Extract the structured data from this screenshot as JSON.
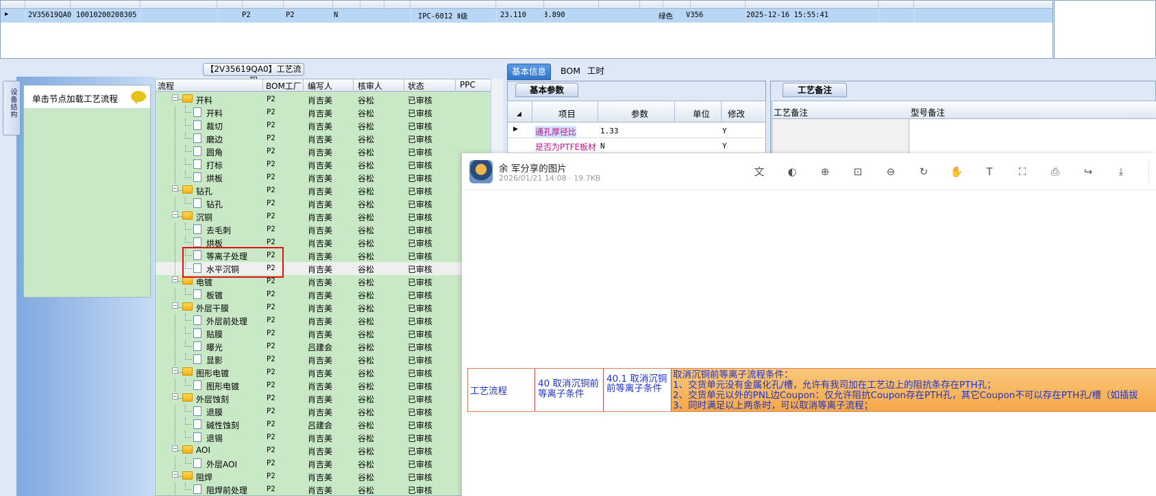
{
  "top_grid": {
    "row": {
      "code": "2V35619QA0",
      "order_no": "10010200208305",
      "factory1": "P2",
      "factory2": "P2",
      "flag": "N",
      "grade": "IPC-6012 Ⅱ级",
      "v1": "23.110",
      "v2": "8.890",
      "color": "绿色",
      "version": "V356",
      "datetime": "2025-12-16 15:55:41"
    }
  },
  "left_panel": {
    "vertical_tab": "设备结构",
    "hint": "单击节点加载工艺流程"
  },
  "process_panel": {
    "title": "【2V35619QA0】工艺流程",
    "columns": [
      "流程",
      "BOM工厂",
      "编写人",
      "核审人",
      "状态",
      "PPC"
    ],
    "rows": [
      {
        "name": "开料",
        "folder": true,
        "factory": "P2",
        "writer": "肖吉美",
        "reviewer": "谷松",
        "status": "已审核"
      },
      {
        "name": "开料",
        "folder": false,
        "factory": "P2",
        "writer": "肖吉美",
        "reviewer": "谷松",
        "status": "已审核"
      },
      {
        "name": "裁切",
        "folder": false,
        "factory": "P2",
        "writer": "肖吉美",
        "reviewer": "谷松",
        "status": "已审核"
      },
      {
        "name": "磨边",
        "folder": false,
        "factory": "P2",
        "writer": "肖吉美",
        "reviewer": "谷松",
        "status": "已审核"
      },
      {
        "name": "圆角",
        "folder": false,
        "factory": "P2",
        "writer": "肖吉美",
        "reviewer": "谷松",
        "status": "已审核"
      },
      {
        "name": "打标",
        "folder": false,
        "factory": "P2",
        "writer": "肖吉美",
        "reviewer": "谷松",
        "status": "已审核"
      },
      {
        "name": "烘板",
        "folder": false,
        "factory": "P2",
        "writer": "肖吉美",
        "reviewer": "谷松",
        "status": "已审核"
      },
      {
        "name": "钻孔",
        "folder": true,
        "factory": "P2",
        "writer": "肖吉美",
        "reviewer": "谷松",
        "status": "已审核"
      },
      {
        "name": "钻孔",
        "folder": false,
        "factory": "P2",
        "writer": "肖吉美",
        "reviewer": "谷松",
        "status": "已审核"
      },
      {
        "name": "沉铜",
        "folder": true,
        "factory": "P2",
        "writer": "肖吉美",
        "reviewer": "谷松",
        "status": "已审核"
      },
      {
        "name": "去毛刺",
        "folder": false,
        "factory": "P2",
        "writer": "肖吉美",
        "reviewer": "谷松",
        "status": "已审核"
      },
      {
        "name": "烘板",
        "folder": false,
        "factory": "P2",
        "writer": "肖吉美",
        "reviewer": "谷松",
        "status": "已审核"
      },
      {
        "name": "等离子处理",
        "folder": false,
        "factory": "P2",
        "writer": "肖吉美",
        "reviewer": "谷松",
        "status": "已审核"
      },
      {
        "name": "水平沉铜",
        "folder": false,
        "factory": "P2",
        "writer": "肖吉美",
        "reviewer": "谷松",
        "status": "已审核"
      },
      {
        "name": "电镀",
        "folder": true,
        "factory": "P2",
        "writer": "肖吉美",
        "reviewer": "谷松",
        "status": "已审核"
      },
      {
        "name": "板镀",
        "folder": false,
        "factory": "P2",
        "writer": "肖吉美",
        "reviewer": "谷松",
        "status": "已审核"
      },
      {
        "name": "外层干膜",
        "folder": true,
        "factory": "P2",
        "writer": "肖吉美",
        "reviewer": "谷松",
        "status": "已审核"
      },
      {
        "name": "外层前处理",
        "folder": false,
        "factory": "P2",
        "writer": "肖吉美",
        "reviewer": "谷松",
        "status": "已审核"
      },
      {
        "name": "贴膜",
        "folder": false,
        "factory": "P2",
        "writer": "肖吉美",
        "reviewer": "谷松",
        "status": "已审核"
      },
      {
        "name": "曝光",
        "folder": false,
        "factory": "P2",
        "writer": "吕建会",
        "reviewer": "谷松",
        "status": "已审核"
      },
      {
        "name": "显影",
        "folder": false,
        "factory": "P2",
        "writer": "肖吉美",
        "reviewer": "谷松",
        "status": "已审核"
      },
      {
        "name": "图形电镀",
        "folder": true,
        "factory": "P2",
        "writer": "肖吉美",
        "reviewer": "谷松",
        "status": "已审核"
      },
      {
        "name": "图形电镀",
        "folder": false,
        "factory": "P2",
        "writer": "肖吉美",
        "reviewer": "谷松",
        "status": "已审核"
      },
      {
        "name": "外层蚀刻",
        "folder": true,
        "factory": "P2",
        "writer": "肖吉美",
        "reviewer": "谷松",
        "status": "已审核"
      },
      {
        "name": "退膜",
        "folder": false,
        "factory": "P2",
        "writer": "肖吉美",
        "reviewer": "谷松",
        "status": "已审核"
      },
      {
        "name": "碱性蚀刻",
        "folder": false,
        "factory": "P2",
        "writer": "吕建会",
        "reviewer": "谷松",
        "status": "已审核"
      },
      {
        "name": "退锡",
        "folder": false,
        "factory": "P2",
        "writer": "肖吉美",
        "reviewer": "谷松",
        "status": "已审核"
      },
      {
        "name": "AOI",
        "folder": true,
        "factory": "P2",
        "writer": "肖吉美",
        "reviewer": "谷松",
        "status": "已审核"
      },
      {
        "name": "外层AOI",
        "folder": false,
        "factory": "P2",
        "writer": "肖吉美",
        "reviewer": "谷松",
        "status": "已审核"
      },
      {
        "name": "阻焊",
        "folder": true,
        "factory": "P2",
        "writer": "肖吉美",
        "reviewer": "谷松",
        "status": "已审核"
      },
      {
        "name": "阻焊前处理",
        "folder": false,
        "factory": "P2",
        "writer": "肖吉美",
        "reviewer": "谷松",
        "status": "已审核"
      }
    ]
  },
  "right_tabs": [
    "基本信息",
    "BOM",
    "工时"
  ],
  "basic_params": {
    "tab": "基本参数",
    "columns": [
      "项目",
      "参数",
      "单位",
      "修改"
    ],
    "rows": [
      {
        "name": "通孔厚径比",
        "value": "1.33",
        "unit": "",
        "modify": "Y"
      },
      {
        "name": "是否为PTFE板材",
        "value": "N",
        "unit": "",
        "modify": "Y"
      }
    ]
  },
  "process_notes": {
    "tab": "工艺备注",
    "columns": [
      "工艺备注",
      "型号备注"
    ]
  },
  "viewer": {
    "title": "余 军分享的图片",
    "subtitle": "2026/01/21 14:08 · 19.7KB",
    "tools": [
      "translate-icon",
      "contrast-icon",
      "zoom-in-icon",
      "actual-size-icon",
      "zoom-out-icon",
      "rotate-icon",
      "hand-icon",
      "text-extract-icon",
      "screenshot-icon",
      "print-icon",
      "share-icon",
      "download-icon"
    ],
    "image": {
      "col1": "工艺流程",
      "col2": "40 取消沉铜前等离子条件",
      "col3": "40.1 取消沉铜前等离子条件",
      "lines": [
        "取消沉铜前等离子流程条件：",
        "1、交货单元没有金属化孔/槽，允许有我司加在工艺边上的阻抗条存在PTH孔；",
        "2、交货单元以外的PNL边Coupon：仅允许阻抗Coupon存在PTH孔，其它Coupon不可以存在PTH孔/槽（如插拔",
        "3、同时满足以上两条时，可以取消等离子流程；"
      ]
    }
  }
}
